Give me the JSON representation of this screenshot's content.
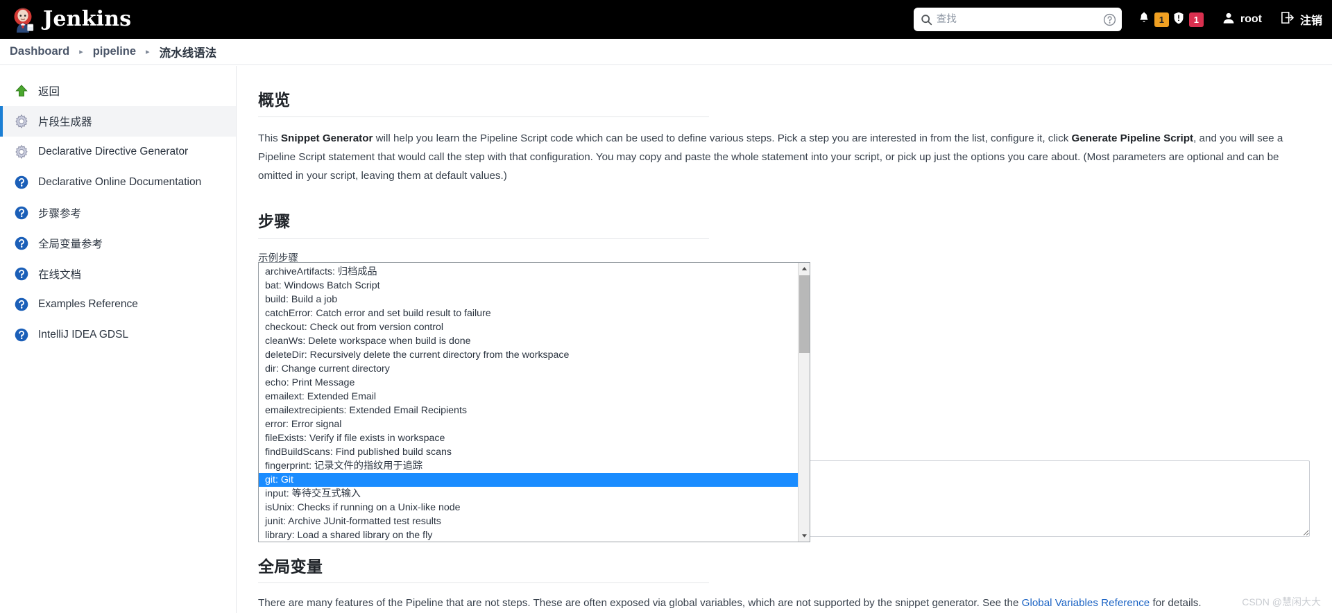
{
  "header": {
    "brand": "Jenkins",
    "logo_icon": "jenkins-butler-logo",
    "search": {
      "icon": "search-icon",
      "value": "",
      "placeholder": "查找"
    },
    "help_icon": "question-circle-icon",
    "notifications": {
      "icon": "bell-icon",
      "count": "1"
    },
    "security": {
      "icon": "shield-warning-icon",
      "count": "1"
    },
    "user": {
      "icon": "person-icon",
      "name": "root"
    },
    "logout": {
      "icon": "logout-icon",
      "label": "注销"
    },
    "colors": {
      "bar_bg": "#000000",
      "badge_amber": "#f0a022",
      "badge_red": "#d9304f"
    }
  },
  "breadcrumb": {
    "separator": "▸",
    "items": [
      {
        "label": "Dashboard"
      },
      {
        "label": "pipeline"
      },
      {
        "label": "流水线语法"
      }
    ]
  },
  "sidebar": {
    "items": [
      {
        "label": "返回",
        "icon": "up-arrow-green-icon",
        "active": false
      },
      {
        "label": "片段生成器",
        "icon": "gear-icon",
        "active": true
      },
      {
        "label": "Declarative Directive Generator",
        "icon": "gear-icon",
        "active": false
      },
      {
        "label": "Declarative Online Documentation",
        "icon": "help-circle-blue-icon",
        "active": false
      },
      {
        "label": "步骤参考",
        "icon": "help-circle-blue-icon",
        "active": false
      },
      {
        "label": "全局变量参考",
        "icon": "help-circle-blue-icon",
        "active": false
      },
      {
        "label": "在线文档",
        "icon": "help-circle-blue-icon",
        "active": false
      },
      {
        "label": "Examples Reference",
        "icon": "help-circle-blue-icon",
        "active": false
      },
      {
        "label": "IntelliJ IDEA GDSL",
        "icon": "help-circle-blue-icon",
        "active": false
      }
    ],
    "active_accent": "#1b7fd4"
  },
  "overview": {
    "title": "概览",
    "text_1": "This ",
    "strong_1": "Snippet Generator",
    "text_2": " will help you learn the Pipeline Script code which can be used to define various steps. Pick a step you are interested in from the list, configure it, click ",
    "strong_2": "Generate Pipeline Script",
    "text_3": ", and you will see a Pipeline Script statement that would call the step with that configuration. You may copy and paste the whole statement into your script, or pick up just the options you care about. (Most parameters are optional and can be omitted in your script, leaving them at default values.)"
  },
  "steps": {
    "title": "步骤",
    "field_label": "示例步骤",
    "select": {
      "selected_value": "archiveArtifacts: 归档成品",
      "caret_icon": "chevron-down-icon",
      "expanded": true,
      "highlighted_value": "git: Git",
      "highlight_color": "#1a8cff",
      "options": [
        "archiveArtifacts: 归档成品",
        "bat: Windows Batch Script",
        "build: Build a job",
        "catchError: Catch error and set build result to failure",
        "checkout: Check out from version control",
        "cleanWs: Delete workspace when build is done",
        "deleteDir: Recursively delete the current directory from the workspace",
        "dir: Change current directory",
        "echo: Print Message",
        "emailext: Extended Email",
        "emailextrecipients: Extended Email Recipients",
        "error: Error signal",
        "fileExists: Verify if file exists in workspace",
        "findBuildScans: Find published build scans",
        "fingerprint: 记录文件的指纹用于追踪",
        "git: Git",
        "input: 等待交互式输入",
        "isUnix: Checks if running on a Unix-like node",
        "junit: Archive JUnit-formatted test results",
        "library: Load a shared library on the fly"
      ],
      "scrollbar": {
        "up_arrow_icon": "scroll-up-arrow-icon",
        "down_arrow_icon": "scroll-down-arrow-icon"
      }
    },
    "generated_script": {
      "value": "",
      "placeholder": ""
    }
  },
  "global_variables": {
    "title": "全局变量",
    "text_1": "There are many features of the Pipeline that are not steps. These are often exposed via global variables, which are not supported by the snippet generator. See the ",
    "link": "Global Variables Reference",
    "text_2": " for details.",
    "link_color": "#1b63c4"
  },
  "watermark": {
    "text": "CSDN @慧闲大大"
  }
}
